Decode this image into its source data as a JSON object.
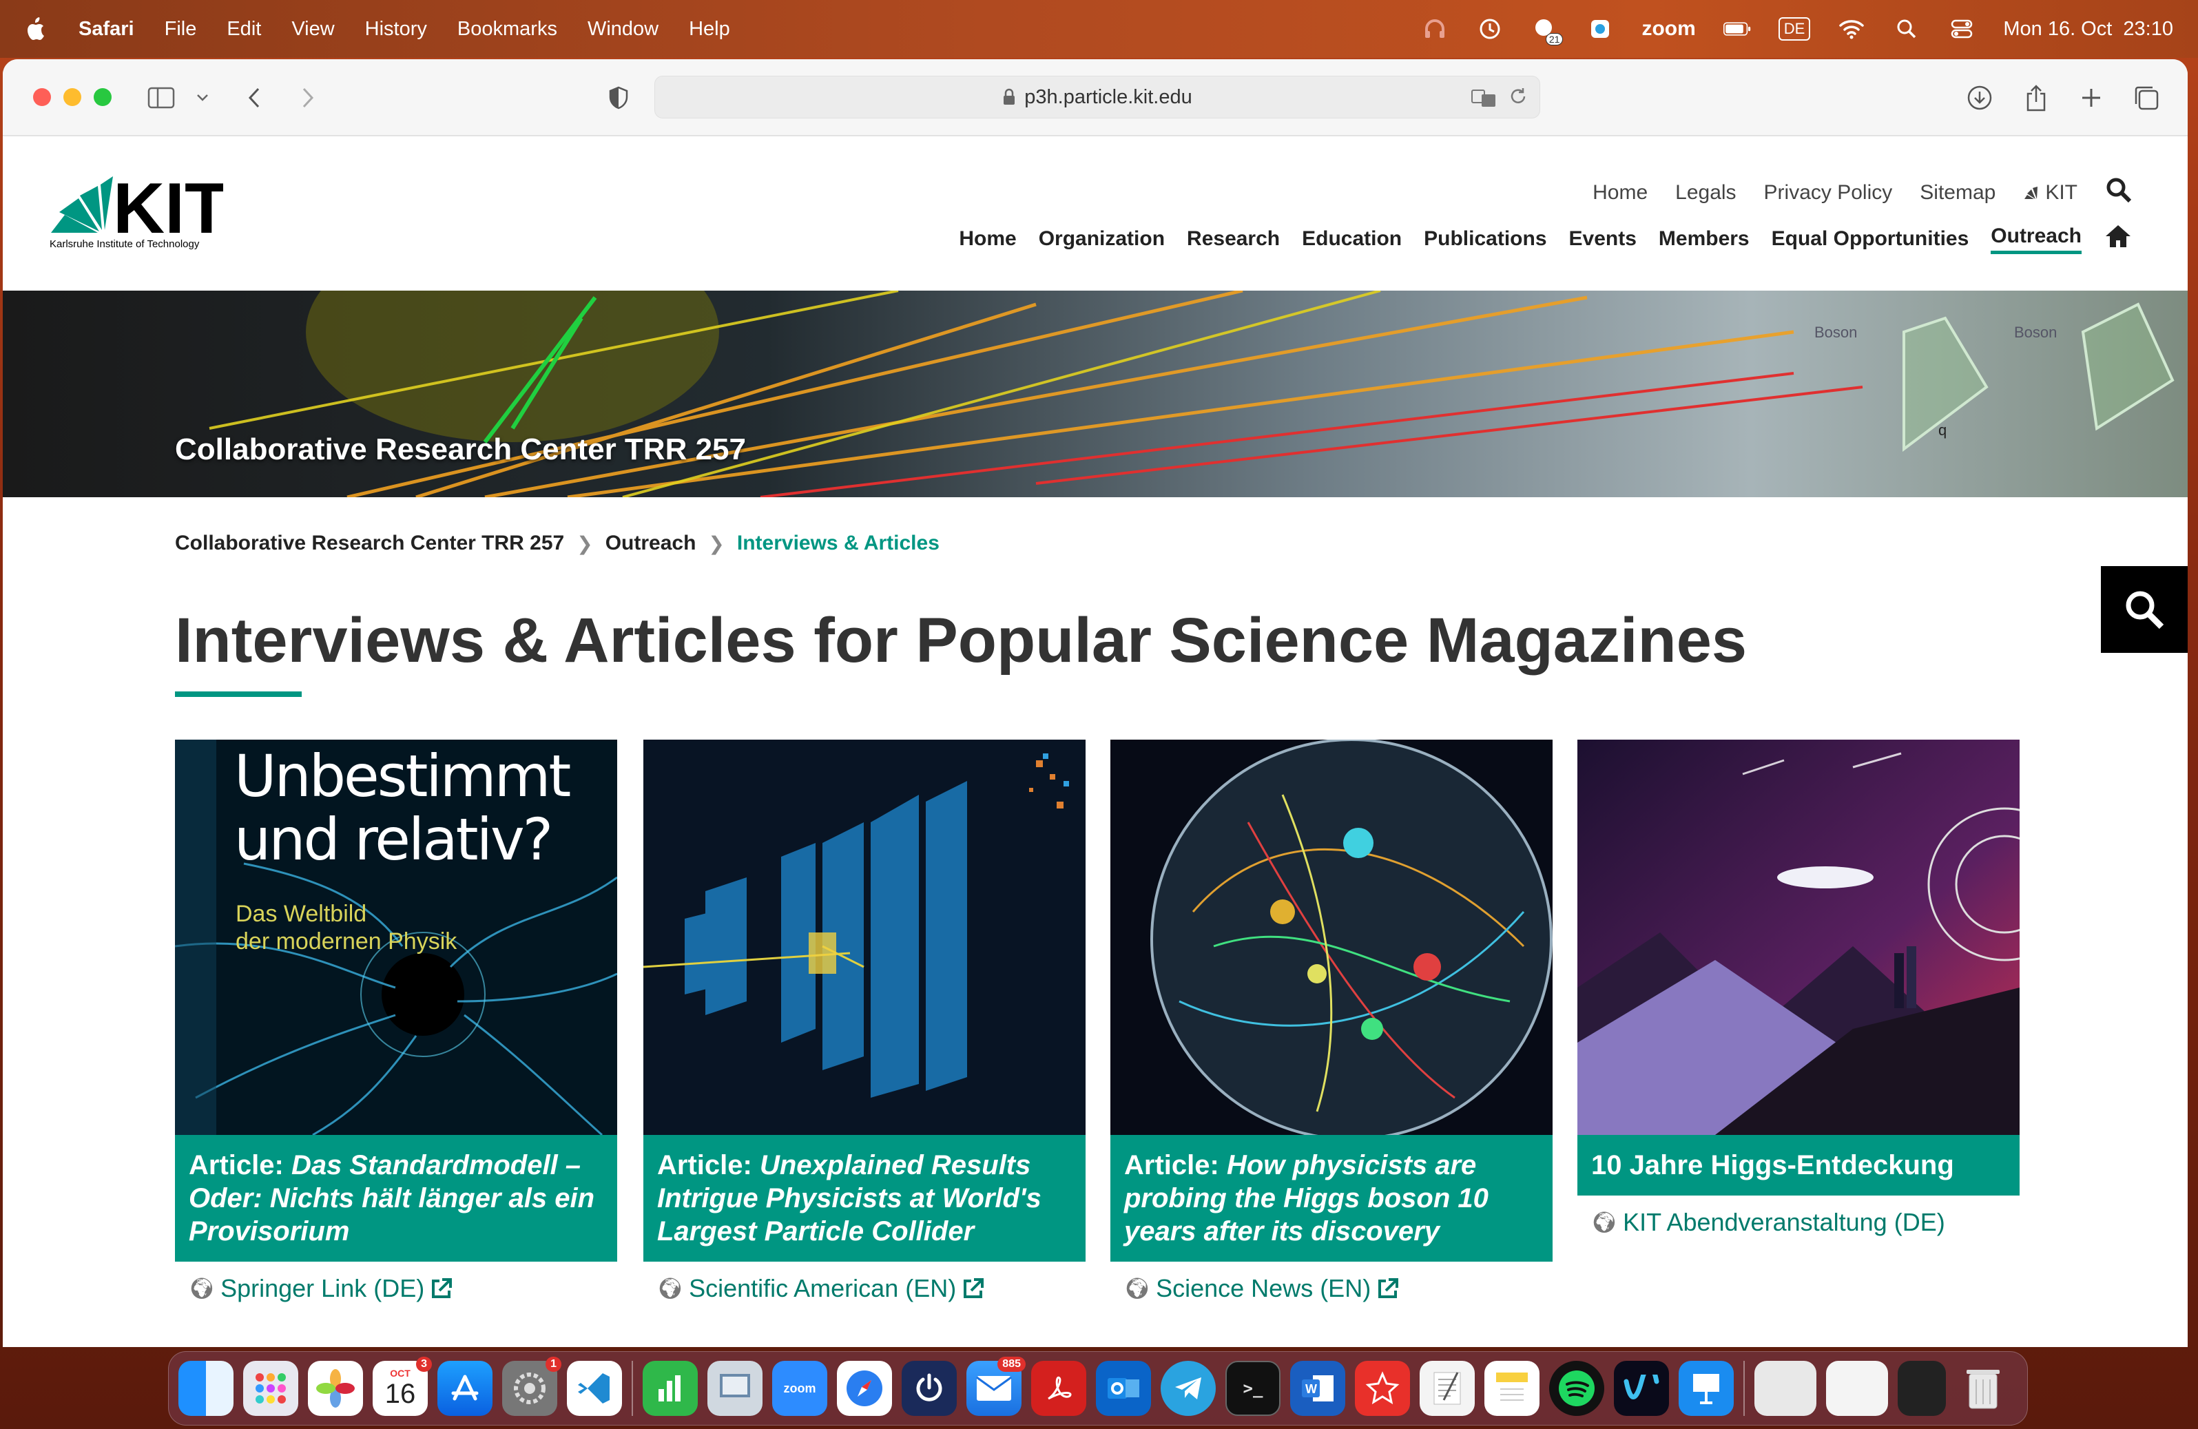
{
  "menubar": {
    "app": "Safari",
    "items": [
      "File",
      "Edit",
      "View",
      "History",
      "Bookmarks",
      "Window",
      "Help"
    ],
    "status": {
      "zoom_label": "zoom",
      "keyboard_layout": "DE",
      "clock": "Mon 16. Oct  23:10",
      "notification_count": "21"
    }
  },
  "browser": {
    "url": "p3h.particle.kit.edu"
  },
  "site": {
    "logo_text": "KIT",
    "logo_subtitle": "Karlsruhe Institute of Technology",
    "service_nav": [
      "Home",
      "Legals",
      "Privacy Policy",
      "Sitemap",
      "KIT"
    ],
    "main_nav": [
      "Home",
      "Organization",
      "Research",
      "Education",
      "Publications",
      "Events",
      "Members",
      "Equal Opportunities",
      "Outreach"
    ],
    "active_nav": "Outreach",
    "hero_title": "Collaborative Research Center TRR 257",
    "hero_labels": [
      "Boson",
      "Boson",
      "q"
    ],
    "breadcrumb": [
      "Collaborative Research Center TRR 257",
      "Outreach",
      "Interviews & Articles"
    ],
    "page_title": "Interviews & Articles for Popular Science Magazines",
    "accent_color": "#009682"
  },
  "cards": [
    {
      "cover_title_1": "Unbestimmt",
      "cover_title_2": "und relativ?",
      "cover_sub_1": "Das Weltbild",
      "cover_sub_2": "der modernen Physik",
      "prefix": "Article: ",
      "title": "Das Standardmodell – Oder: Nichts hält länger als ein Provisorium",
      "link": "Springer Link (DE)"
    },
    {
      "prefix": "Article: ",
      "title": "Unexplained Results Intrigue Physicists at World's Largest Particle Collider",
      "link": "Scientific American (EN)"
    },
    {
      "prefix": "Article: ",
      "title": "How physicists are probing the Higgs boson 10 years after its discovery",
      "link": "Science News (EN)"
    },
    {
      "prefix": "",
      "title": "10 Jahre Higgs-Entdeckung",
      "link": "KIT Abendveranstaltung (DE)"
    }
  ],
  "dock": {
    "calendar_month": "OCT",
    "calendar_day": "16",
    "calendar_badge": "3",
    "settings_badge": "1",
    "mail_badge": "885",
    "zoom_label": "zoom"
  }
}
